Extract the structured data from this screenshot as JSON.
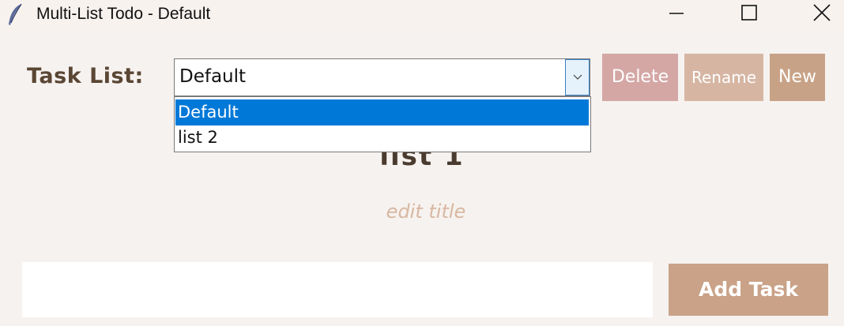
{
  "window": {
    "title": "Multi-List Todo - Default",
    "icons": {
      "app": "feather-icon",
      "minimize": "minimize-icon",
      "maximize": "maximize-icon",
      "close": "close-icon"
    }
  },
  "toolbar": {
    "task_list_label": "Task List:",
    "selected_list": "Default",
    "delete_label": "Delete",
    "rename_label": "Rename",
    "new_label": "New"
  },
  "dropdown": {
    "options": [
      "Default",
      "list 2"
    ],
    "highlighted_index": 0
  },
  "main": {
    "list_title": "list 1",
    "edit_title_link": "edit title"
  },
  "add_task": {
    "input_value": "",
    "button_label": "Add Task"
  },
  "colors": {
    "background": "#f6f2ef",
    "delete_button": "#d4a7a5",
    "rename_button": "#d6b6a3",
    "new_button": "#c8a286",
    "add_task_button": "#c9a287",
    "selection": "#0078d7",
    "label_text": "#5a4634"
  }
}
